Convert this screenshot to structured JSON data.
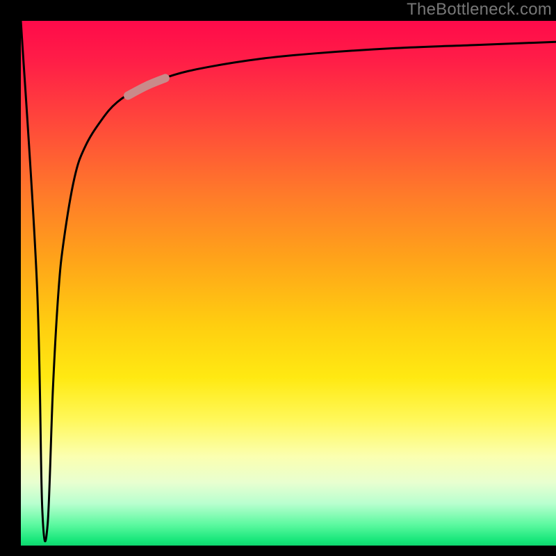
{
  "watermark": "TheBottleneck.com",
  "chart_data": {
    "type": "line",
    "title": "",
    "xlabel": "",
    "ylabel": "",
    "xlim": [
      0,
      100
    ],
    "ylim": [
      0,
      100
    ],
    "grid": false,
    "legend": false,
    "series": [
      {
        "name": "bottleneck-curve",
        "x": [
          0,
          3,
          4,
          5,
          6,
          7,
          8,
          10,
          12,
          15,
          18,
          22,
          28,
          35,
          45,
          55,
          70,
          85,
          100
        ],
        "y": [
          100,
          50,
          7,
          4,
          30,
          48,
          58,
          70,
          76,
          81,
          84.5,
          87,
          89.5,
          91.2,
          92.8,
          93.8,
          94.8,
          95.4,
          96
        ]
      }
    ],
    "highlight_segment": {
      "series": "bottleneck-curve",
      "x_start": 20,
      "x_end": 27,
      "color": "#c98a8a"
    },
    "background_gradient": {
      "direction": "vertical",
      "stops": [
        {
          "pos": 0.0,
          "color": "#ff0a4a"
        },
        {
          "pos": 0.5,
          "color": "#ffd010"
        },
        {
          "pos": 0.8,
          "color": "#fff85a"
        },
        {
          "pos": 1.0,
          "color": "#0fd66f"
        }
      ]
    }
  }
}
